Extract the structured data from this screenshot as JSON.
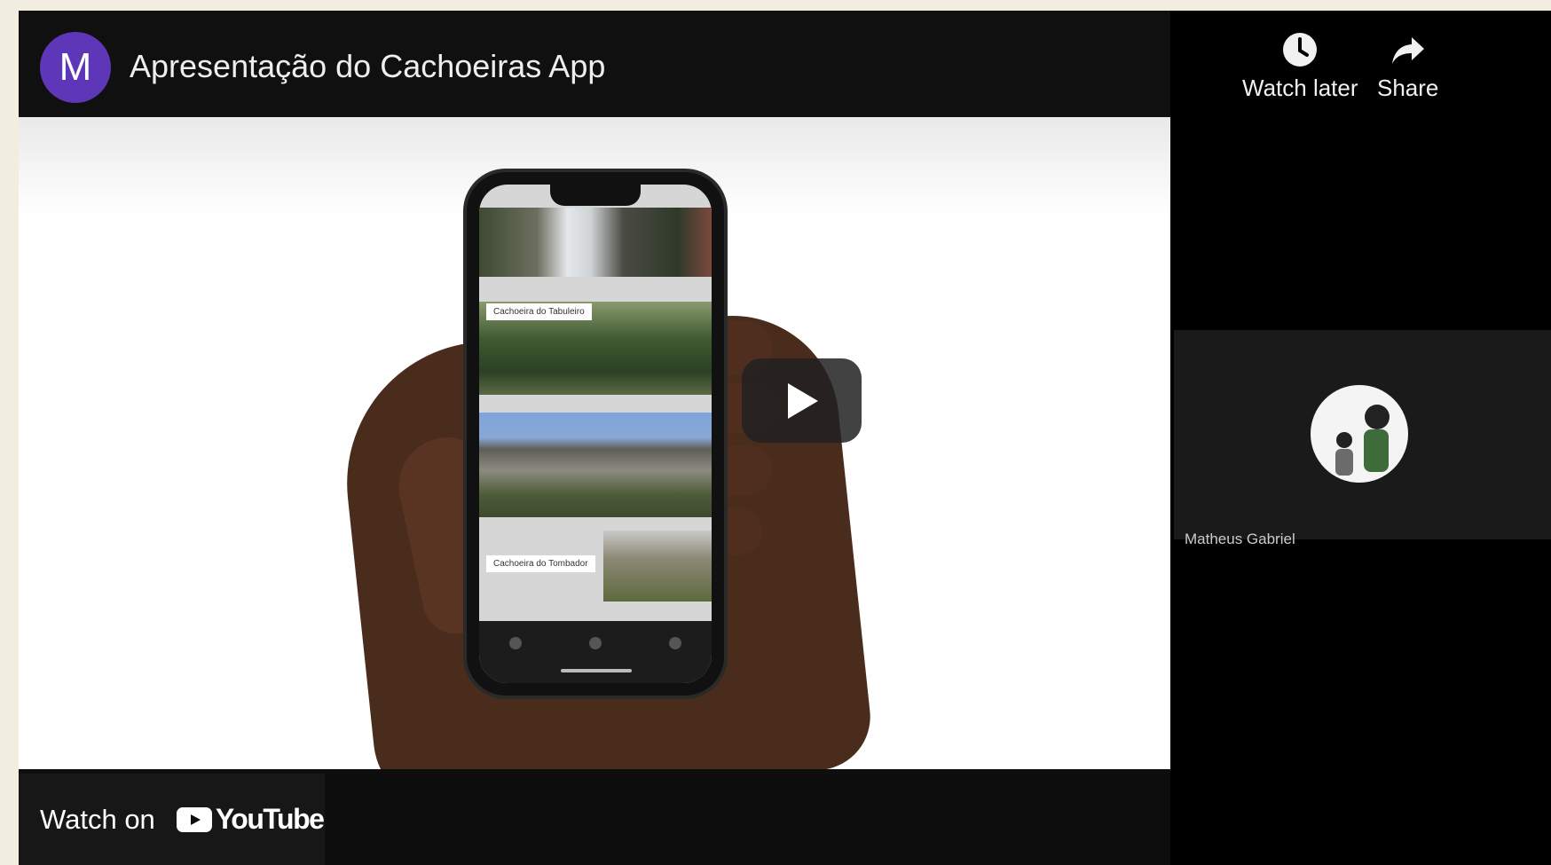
{
  "player": {
    "channel_avatar_letter": "M",
    "video_title": "Apresentação do Cachoeiras App"
  },
  "actions": {
    "watch_later_label": "Watch later",
    "share_label": "Share"
  },
  "bottom": {
    "watch_on_label": "Watch on",
    "youtube_word": "YouTube"
  },
  "endcard": {
    "channel_name": "Matheus Gabriel"
  },
  "phone_screen": {
    "card_labels": [
      "Cachoeira do Tabuleiro",
      "Cachoeira do Tombador"
    ]
  },
  "icons": {
    "play": "play-icon",
    "watch_later": "clock-icon",
    "share": "share-arrow-icon",
    "youtube": "youtube-logo-icon"
  },
  "colors": {
    "avatar_purple": "#5d37b8",
    "youtube_red": "#ff0000",
    "page_bg": "#f1ede1"
  }
}
